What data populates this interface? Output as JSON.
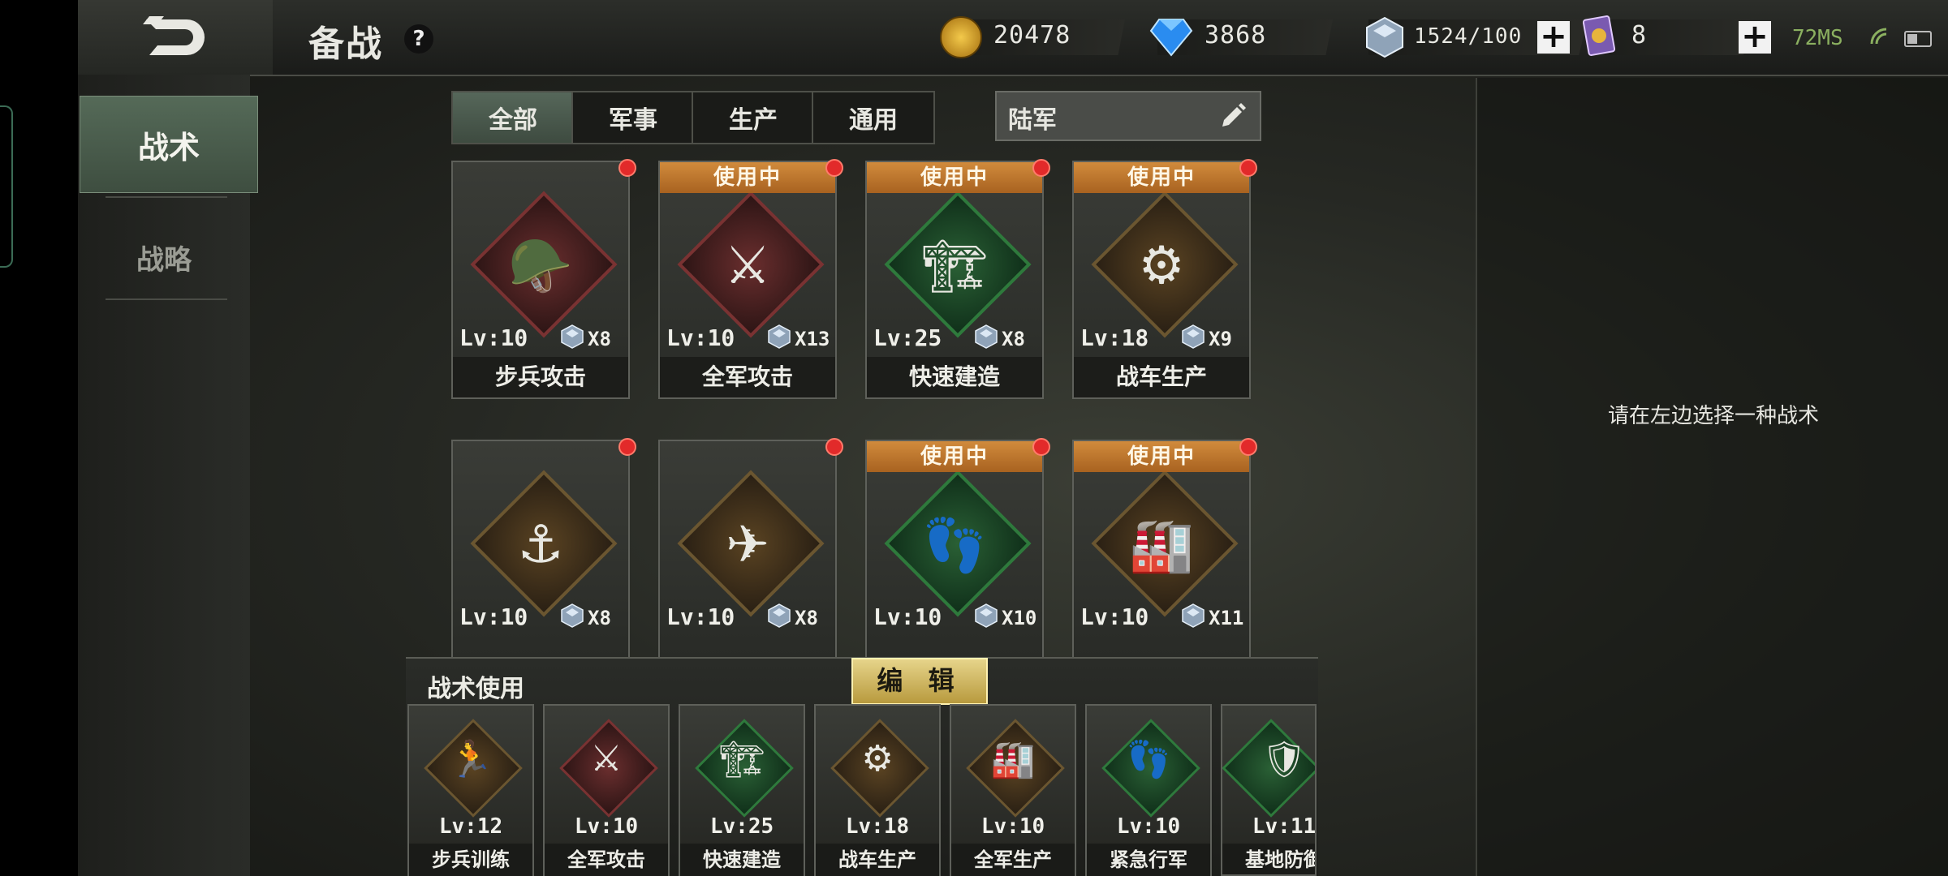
{
  "header": {
    "title": "备战",
    "help": "?",
    "gold": "20478",
    "diamond": "3868",
    "crystal": "1524/100",
    "card_tokens": "8",
    "ping": "72MS"
  },
  "sidebar": {
    "items": [
      {
        "label": "战术"
      },
      {
        "label": "战略"
      }
    ]
  },
  "filters": {
    "tabs": [
      {
        "label": "全部"
      },
      {
        "label": "军事"
      },
      {
        "label": "生产"
      },
      {
        "label": "通用"
      }
    ],
    "search_value": "陆军"
  },
  "in_use_label": "使用中",
  "tactics": [
    {
      "name": "步兵攻击",
      "level": "Lv:10",
      "count": "X8",
      "in_use": false,
      "theme": "red",
      "icon": "infantry-soldier-icon"
    },
    {
      "name": "全军攻击",
      "level": "Lv:10",
      "count": "X13",
      "in_use": true,
      "theme": "red",
      "icon": "army-attack-icon"
    },
    {
      "name": "快速建造",
      "level": "Lv:25",
      "count": "X8",
      "in_use": true,
      "theme": "green",
      "icon": "construction-crane-icon"
    },
    {
      "name": "战车生产",
      "level": "Lv:18",
      "count": "X9",
      "in_use": true,
      "theme": "gold",
      "icon": "tank-gear-icon"
    },
    {
      "name": "",
      "level": "Lv:10",
      "count": "X8",
      "in_use": false,
      "theme": "gold",
      "icon": "warship-gear-icon"
    },
    {
      "name": "",
      "level": "Lv:10",
      "count": "X8",
      "in_use": false,
      "theme": "gold",
      "icon": "jet-gear-icon"
    },
    {
      "name": "",
      "level": "Lv:10",
      "count": "X10",
      "in_use": true,
      "theme": "green",
      "icon": "squad-march-icon"
    },
    {
      "name": "",
      "level": "Lv:10",
      "count": "X11",
      "in_use": true,
      "theme": "gold",
      "icon": "factory-gear-icon"
    }
  ],
  "use_panel": {
    "title": "战术使用",
    "edit_label": "编 辑",
    "slots": [
      {
        "name": "步兵训练",
        "level": "Lv:12",
        "theme": "gold",
        "icon": "infantry-training-icon"
      },
      {
        "name": "全军攻击",
        "level": "Lv:10",
        "theme": "red",
        "icon": "army-attack-icon"
      },
      {
        "name": "快速建造",
        "level": "Lv:25",
        "theme": "green",
        "icon": "construction-crane-icon"
      },
      {
        "name": "战车生产",
        "level": "Lv:18",
        "theme": "gold",
        "icon": "tank-gear-icon"
      },
      {
        "name": "全军生产",
        "level": "Lv:10",
        "theme": "gold",
        "icon": "factory-gear-icon"
      },
      {
        "name": "紧急行军",
        "level": "Lv:10",
        "theme": "green",
        "icon": "squad-march-icon"
      },
      {
        "name": "基地防御",
        "level": "Lv:11",
        "theme": "green",
        "icon": "base-defense-icon"
      }
    ]
  },
  "right_panel": {
    "hint": "请在左边选择一种战术"
  },
  "colors": {
    "accent_green": "#56675a",
    "in_use_orange": "#d18b3c",
    "edit_gold": "#e6d48a",
    "alert_red": "#e22a2a"
  }
}
